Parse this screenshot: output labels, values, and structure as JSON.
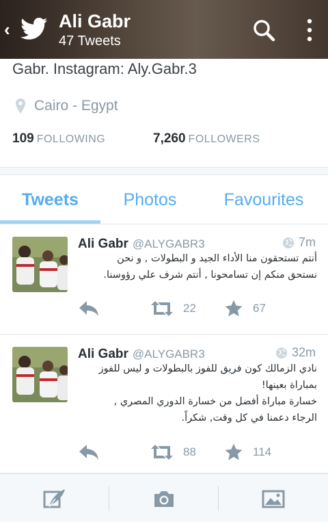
{
  "header": {
    "title": "Ali Gabr",
    "subtitle": "47 Tweets"
  },
  "profile": {
    "bio": "Gabr. Instagram: Aly.Gabr.3",
    "location": "Cairo - Egypt",
    "following_count": "109",
    "following_label": "FOLLOWING",
    "followers_count": "7,260",
    "followers_label": "FOLLOWERS"
  },
  "tabs": [
    {
      "label": "Tweets",
      "active": true
    },
    {
      "label": "Photos",
      "active": false
    },
    {
      "label": "Favourites",
      "active": false
    }
  ],
  "tweets": [
    {
      "name": "Ali Gabr",
      "handle": "@ALYGABR3",
      "time": "7m",
      "text": "أنتم تستحقون منا الأداء الجيد و البطولات , و نحن\nنستحق منكم إن تسامحونا , أنتم شرف علي رؤوسنا.",
      "retweets": "22",
      "favorites": "67"
    },
    {
      "name": "Ali Gabr",
      "handle": "@ALYGABR3",
      "time": "32m",
      "text": "نادي الزمالك كون فريق للفوز بالبطولات و ليس للفوز\nبمباراة بعينها!\nخسارة مباراة أفضل من خسارة الدوري المصري ,\nالرجاء دعمنا في كل وقت, شكراً.",
      "retweets": "88",
      "favorites": "114"
    }
  ],
  "colors": {
    "accent": "#55acee",
    "muted": "#8899a6",
    "text": "#292f33"
  }
}
